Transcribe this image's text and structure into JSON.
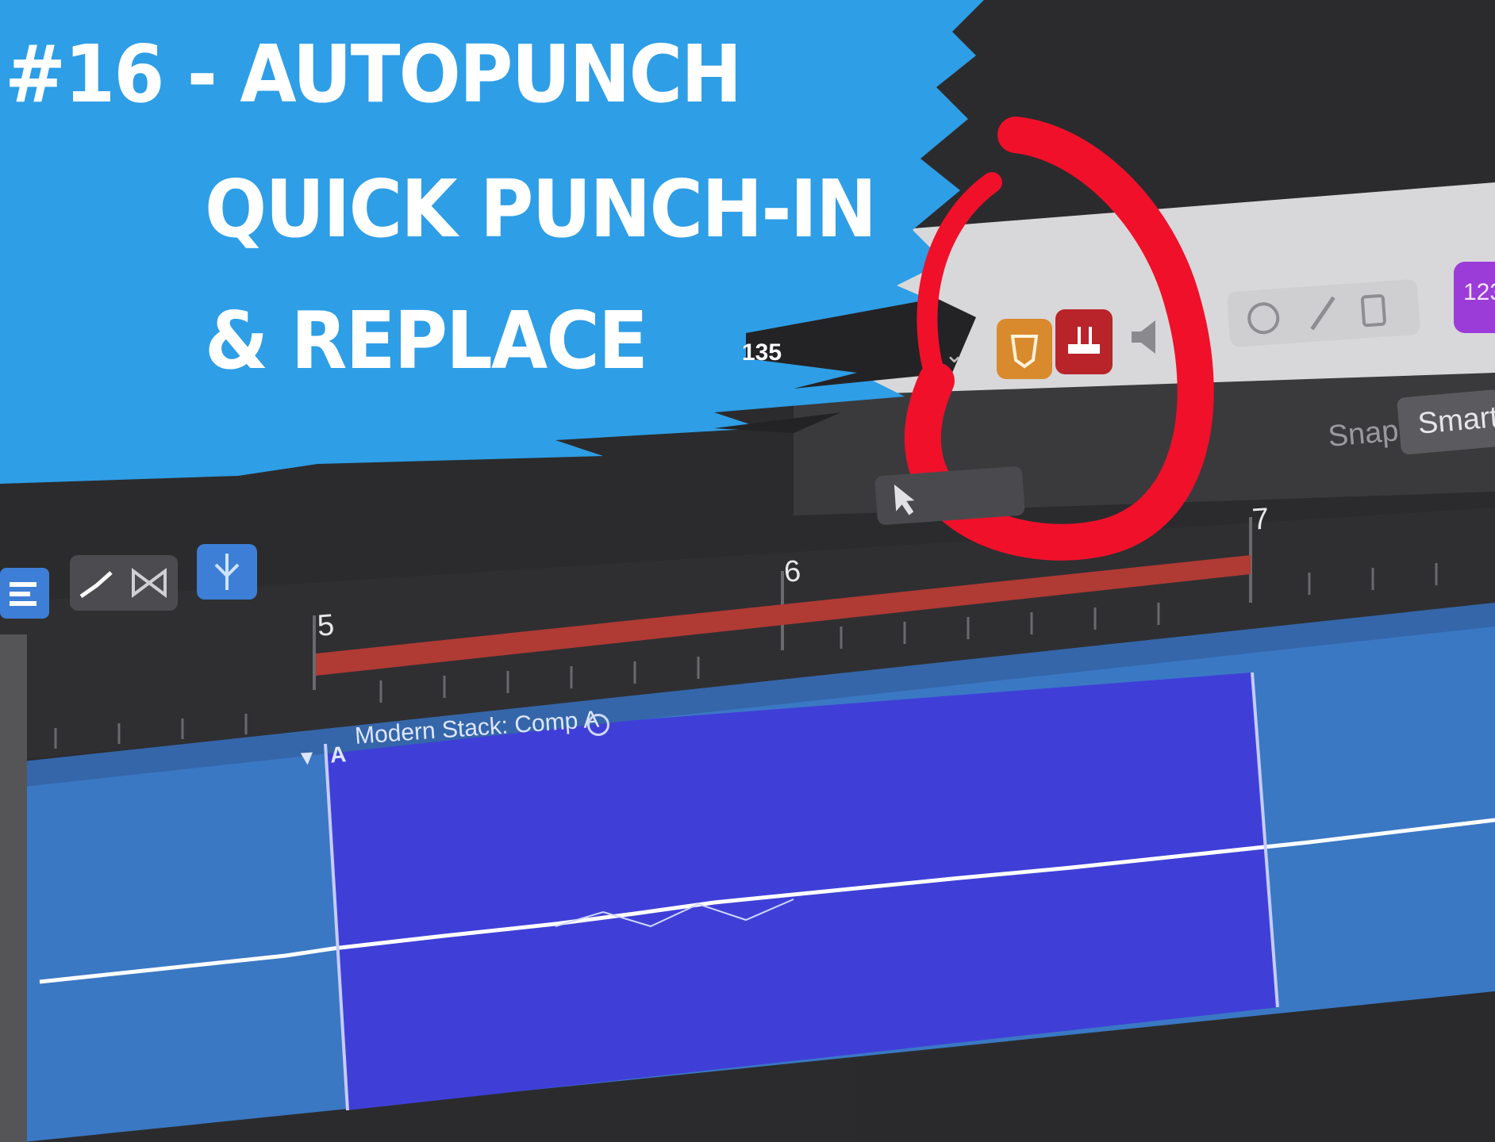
{
  "thumbnail": {
    "title_lines": [
      "#16 - AUTOPUNCH",
      "QUICK PUNCH-IN",
      "& REPLACE"
    ]
  },
  "toolbar": {
    "tempo_display": "135",
    "snap_label": "Snap:",
    "snap_value": "Smart",
    "smart_badge_text": "123"
  },
  "ruler": {
    "bar_numbers": [
      "5",
      "6",
      "7"
    ]
  },
  "region": {
    "disclosure": "▼",
    "take_letter": "A",
    "name": "Modern Stack: Comp A"
  },
  "colors": {
    "banner_blue": "#2e9ee6",
    "annotation_red": "#f0102a",
    "region_selected": "#3f3fd8",
    "region_unselected": "#3a78c4",
    "autopunch_bar": "#b03a34",
    "autopunch_button": "#b8242a",
    "count_in_button": "#d98a2c"
  },
  "icons": [
    "chevron-down-icon",
    "autopunch-icon",
    "count-in-icon",
    "speaker-icon",
    "pointer-tool-icon",
    "tuner-icon",
    "pencil-icon",
    "score-icon"
  ]
}
